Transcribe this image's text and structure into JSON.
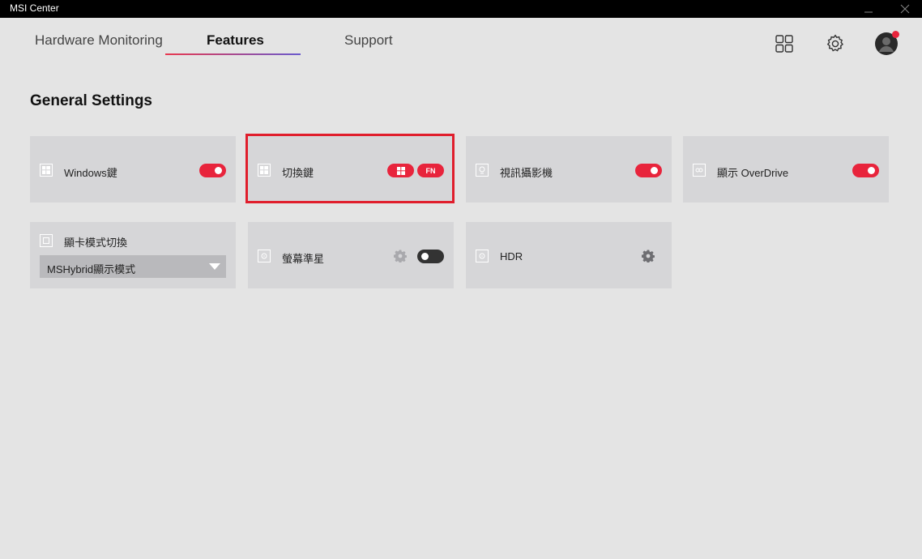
{
  "window": {
    "title": "MSI Center"
  },
  "tabs": [
    {
      "label": "Hardware Monitoring"
    },
    {
      "label": "Features"
    },
    {
      "label": "Support"
    }
  ],
  "active_tab": "Features",
  "section": {
    "title": "General Settings"
  },
  "cards": {
    "windows_key": {
      "label": "Windows鍵",
      "toggle": "on"
    },
    "switch_key": {
      "label": "切換鍵",
      "badges": [
        "FN"
      ]
    },
    "webcam": {
      "label": "視訊攝影機",
      "toggle": "on"
    },
    "overdrive": {
      "label": "顯示 OverDrive",
      "toggle": "on"
    },
    "gpu_mode": {
      "label": "顯卡模式切換",
      "selected": "MSHybrid顯示模式"
    },
    "crosshair": {
      "label": "螢幕準星",
      "toggle": "off"
    },
    "hdr": {
      "label": "HDR"
    }
  },
  "colors": {
    "accent": "#e8243c",
    "highlight": "#e01e2c",
    "card_bg": "#d6d6d8",
    "page_bg": "#e4e4e4"
  },
  "icons": [
    "minimize-icon",
    "close-icon",
    "apps-grid-icon",
    "gear-icon",
    "user-avatar-icon",
    "windows-logo-icon",
    "webcam-icon",
    "overdrive-icon",
    "gpu-icon",
    "crosshair-icon",
    "hdr-icon",
    "settings-gear-icon",
    "dropdown-arrow-icon"
  ]
}
